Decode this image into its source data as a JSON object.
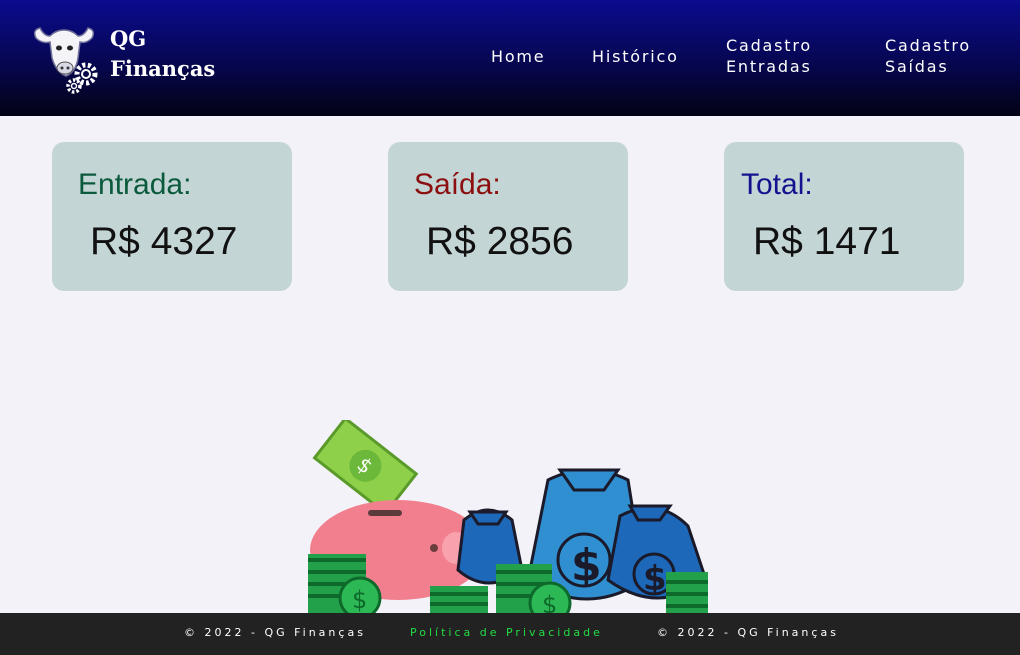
{
  "brand": {
    "line1": "QG",
    "line2": "Finanças",
    "logo_icon": "cow-gear-icon"
  },
  "nav": {
    "home": "Home",
    "historico": "Histórico",
    "cad_entradas_1": "Cadastro",
    "cad_entradas_2": "Entradas",
    "cad_saidas_1": "Cadastro",
    "cad_saidas_2": "Saídas"
  },
  "cards": {
    "entrada": {
      "label": "Entrada:",
      "value": "R$ 4327",
      "color": "#0b5a3c"
    },
    "saida": {
      "label": "Saída:",
      "value": "R$ 2856",
      "color": "#8b0f0f"
    },
    "total": {
      "label": "Total:",
      "value": "R$ 1471",
      "color": "#13138f"
    }
  },
  "illustration": {
    "icon": "piggy-bank-money-bags-icon"
  },
  "footer": {
    "copyright_left": "© 2022 - QG Finanças",
    "policy": "Política de Privacidade",
    "copyright_right": "© 2022 - QG Finanças"
  }
}
